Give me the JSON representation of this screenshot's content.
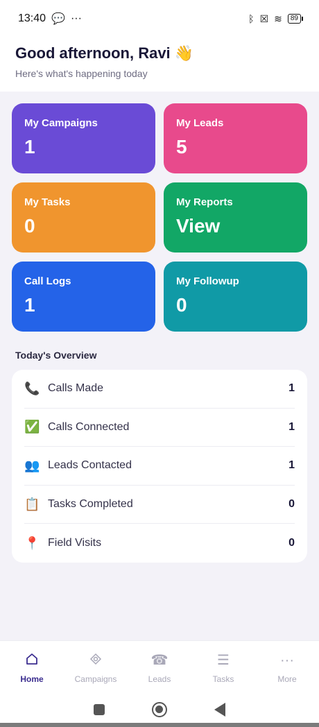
{
  "status_bar": {
    "time": "13:40",
    "battery": "89"
  },
  "header": {
    "greeting": "Good afternoon, Ravi 👋",
    "subtitle": "Here's what's happening today"
  },
  "cards": [
    {
      "title": "My Campaigns",
      "value": "1",
      "color": "#6a4bd6"
    },
    {
      "title": "My Leads",
      "value": "5",
      "color": "#e84a8c"
    },
    {
      "title": "My Tasks",
      "value": "0",
      "color": "#f0952e"
    },
    {
      "title": "My Reports",
      "value": "View",
      "color": "#12a766"
    },
    {
      "title": "Call Logs",
      "value": "1",
      "color": "#2463e8"
    },
    {
      "title": "My Followup",
      "value": "0",
      "color": "#109aa6"
    }
  ],
  "overview": {
    "title": "Today's Overview",
    "rows": [
      {
        "icon": "📞",
        "label": "Calls Made",
        "value": "1"
      },
      {
        "icon": "✅",
        "label": "Calls Connected",
        "value": "1"
      },
      {
        "icon": "👥",
        "label": "Leads Contacted",
        "value": "1"
      },
      {
        "icon": "📋",
        "label": "Tasks Completed",
        "value": "0"
      },
      {
        "icon": "📍",
        "label": "Field Visits",
        "value": "0"
      }
    ]
  },
  "bottom_nav": [
    {
      "label": "Home",
      "icon": "home-icon",
      "active": true
    },
    {
      "label": "Campaigns",
      "icon": "diamond-icon",
      "active": false
    },
    {
      "label": "Leads",
      "icon": "phone-icon",
      "active": false
    },
    {
      "label": "Tasks",
      "icon": "list-icon",
      "active": false
    },
    {
      "label": "More",
      "icon": "more-icon",
      "active": false
    }
  ]
}
